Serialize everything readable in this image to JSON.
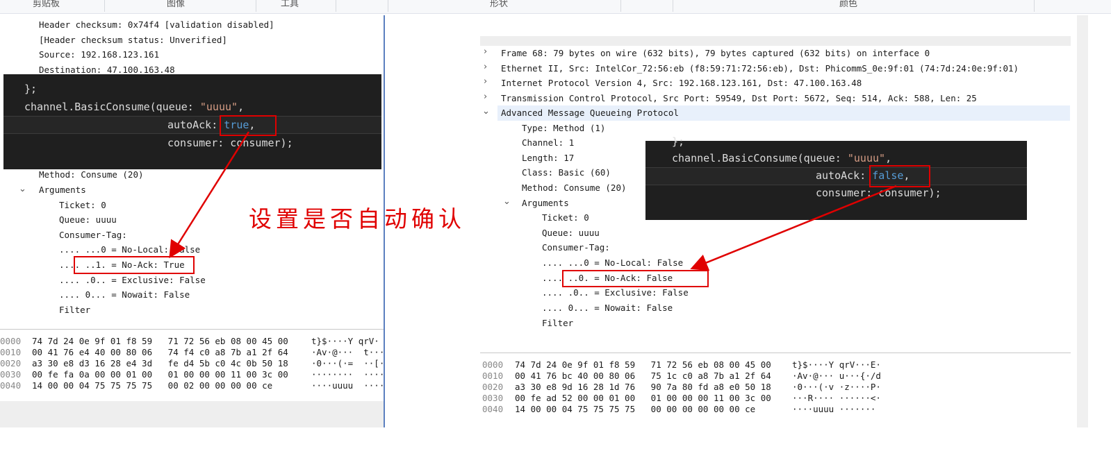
{
  "ribbon": {
    "groups": [
      "剪贴板",
      "图像",
      "工具",
      "形状",
      "颜色"
    ]
  },
  "left": {
    "tree_top": [
      "Header checksum: 0x74f4 [validation disabled]",
      "[Header checksum status: Unverified]",
      "Source: 192.168.123.161",
      "Destination: 47.100.163.48"
    ],
    "code": {
      "line0": "};",
      "line1_a": "channel.BasicConsume(queue: ",
      "line1_str": "\"uuuu\"",
      "line1_b": ",",
      "line2_a": "autoAck: ",
      "line2_kw": "true",
      "line2_b": ",",
      "line3": "consumer: consumer);"
    },
    "method": "Method: Consume (20)",
    "arguments_label": "Arguments",
    "args": [
      "Ticket: 0",
      "Queue: uuuu",
      "Consumer-Tag:",
      ".... ...0 = No-Local: False",
      ".... ..1. = No-Ack: True",
      ".... .0.. = Exclusive: False",
      ".... 0... = Nowait: False",
      "Filter"
    ],
    "hex_offsets": [
      "0000",
      "0010",
      "0020",
      "0030",
      "0040"
    ],
    "hex_bytes": [
      "74 7d 24 0e 9f 01 f8 59   71 72 56 eb 08 00 45 00",
      "00 41 76 e4 40 00 80 06   74 f4 c0 a8 7b a1 2f 64",
      "a3 30 e8 d3 16 28 e4 3d   fe d4 5b c0 4c 0b 50 18",
      "00 fe fa 0a 00 00 01 00   01 00 00 00 11 00 3c 00",
      "14 00 00 04 75 75 75 75   00 02 00 00 00 00 ce"
    ],
    "hex_ascii": [
      "t}$····Y qrV·",
      "·Av·@···  t···",
      "·0···(·=  ··[·",
      "········  ····",
      "····uuuu  ····"
    ]
  },
  "annotation": "设置是否自动确认",
  "right": {
    "frames": [
      "Frame 68: 79 bytes on wire (632 bits), 79 bytes captured (632 bits) on interface 0",
      "Ethernet II, Src: IntelCor_72:56:eb (f8:59:71:72:56:eb), Dst: PhicommS_0e:9f:01 (74:7d:24:0e:9f:01)",
      "Internet Protocol Version 4, Src: 192.168.123.161, Dst: 47.100.163.48",
      "Transmission Control Protocol, Src Port: 59549, Dst Port: 5672, Seq: 514, Ack: 588, Len: 25",
      "Advanced Message Queueing Protocol"
    ],
    "amqp": [
      "Type: Method (1)",
      "Channel: 1",
      "Length: 17",
      "Class: Basic (60)",
      "Method: Consume (20)"
    ],
    "arguments_label": "Arguments",
    "args": [
      "Ticket: 0",
      "Queue: uuuu",
      "Consumer-Tag:",
      ".... ...0 = No-Local: False",
      ".... ..0. = No-Ack: False",
      ".... .0.. = Exclusive: False",
      ".... 0... = Nowait: False",
      "Filter"
    ],
    "code": {
      "line0": "};",
      "line1_a": "channel.BasicConsume(queue: ",
      "line1_str": "\"uuuu\"",
      "line1_b": ",",
      "line2_a": "autoAck: ",
      "line2_kw": "false",
      "line2_b": ",",
      "line3": "consumer: consumer);"
    },
    "hex_offsets": [
      "0000",
      "0010",
      "0020",
      "0030",
      "0040"
    ],
    "hex_bytes": [
      "74 7d 24 0e 9f 01 f8 59   71 72 56 eb 08 00 45 00",
      "00 41 76 bc 40 00 80 06   75 1c c0 a8 7b a1 2f 64",
      "a3 30 e8 9d 16 28 1d 76   90 7a 80 fd a8 e0 50 18",
      "00 fe ad 52 00 00 01 00   01 00 00 00 11 00 3c 00",
      "14 00 00 04 75 75 75 75   00 00 00 00 00 00 ce"
    ],
    "hex_ascii": [
      "t}$····Y qrV···E·",
      "·Av·@··· u···{·/d",
      "·0···(·v ·z····P·",
      "···R···· ······<·",
      "····uuuu ·······"
    ]
  },
  "colors": {
    "annotation_red": "#e00000",
    "selected_row": "#e8f0fb",
    "code_bg": "#1f1f1f",
    "keyword_blue": "#569cd6"
  }
}
